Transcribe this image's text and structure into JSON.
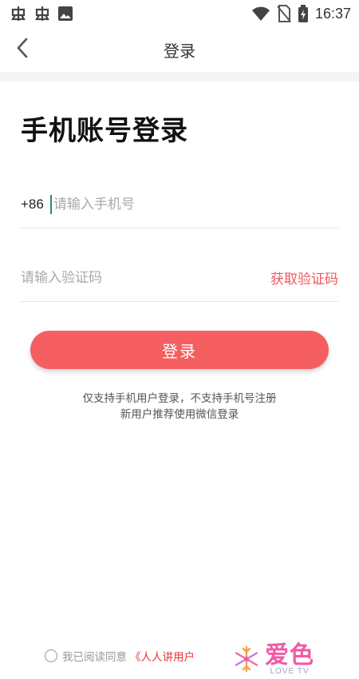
{
  "status_bar": {
    "time": "16:37",
    "icons": [
      "app-notification-icon",
      "app-notification-icon",
      "image-icon",
      "wifi-icon",
      "no-sim-icon",
      "battery-icon"
    ]
  },
  "nav": {
    "back_icon": "chevron-left-icon",
    "title": "登录"
  },
  "main": {
    "heading": "手机账号登录",
    "phone": {
      "country_code": "+86",
      "value": "",
      "placeholder": "请输入手机号"
    },
    "code": {
      "value": "",
      "placeholder": "请输入验证码",
      "get_code_label": "获取验证码"
    },
    "login_label": "登录",
    "notice_line1": "仅支持手机用户登录，不支持手机号注册",
    "notice_line2": "新用户推荐使用微信登录"
  },
  "agreement": {
    "text": "我已阅读同意",
    "link": "《人人讲用户"
  },
  "watermark": {
    "main": "爱色",
    "sub": "LOVE TV"
  },
  "colors": {
    "accent": "#f55f61",
    "link_red": "#f0575c",
    "cursor": "#2a8c7a"
  }
}
